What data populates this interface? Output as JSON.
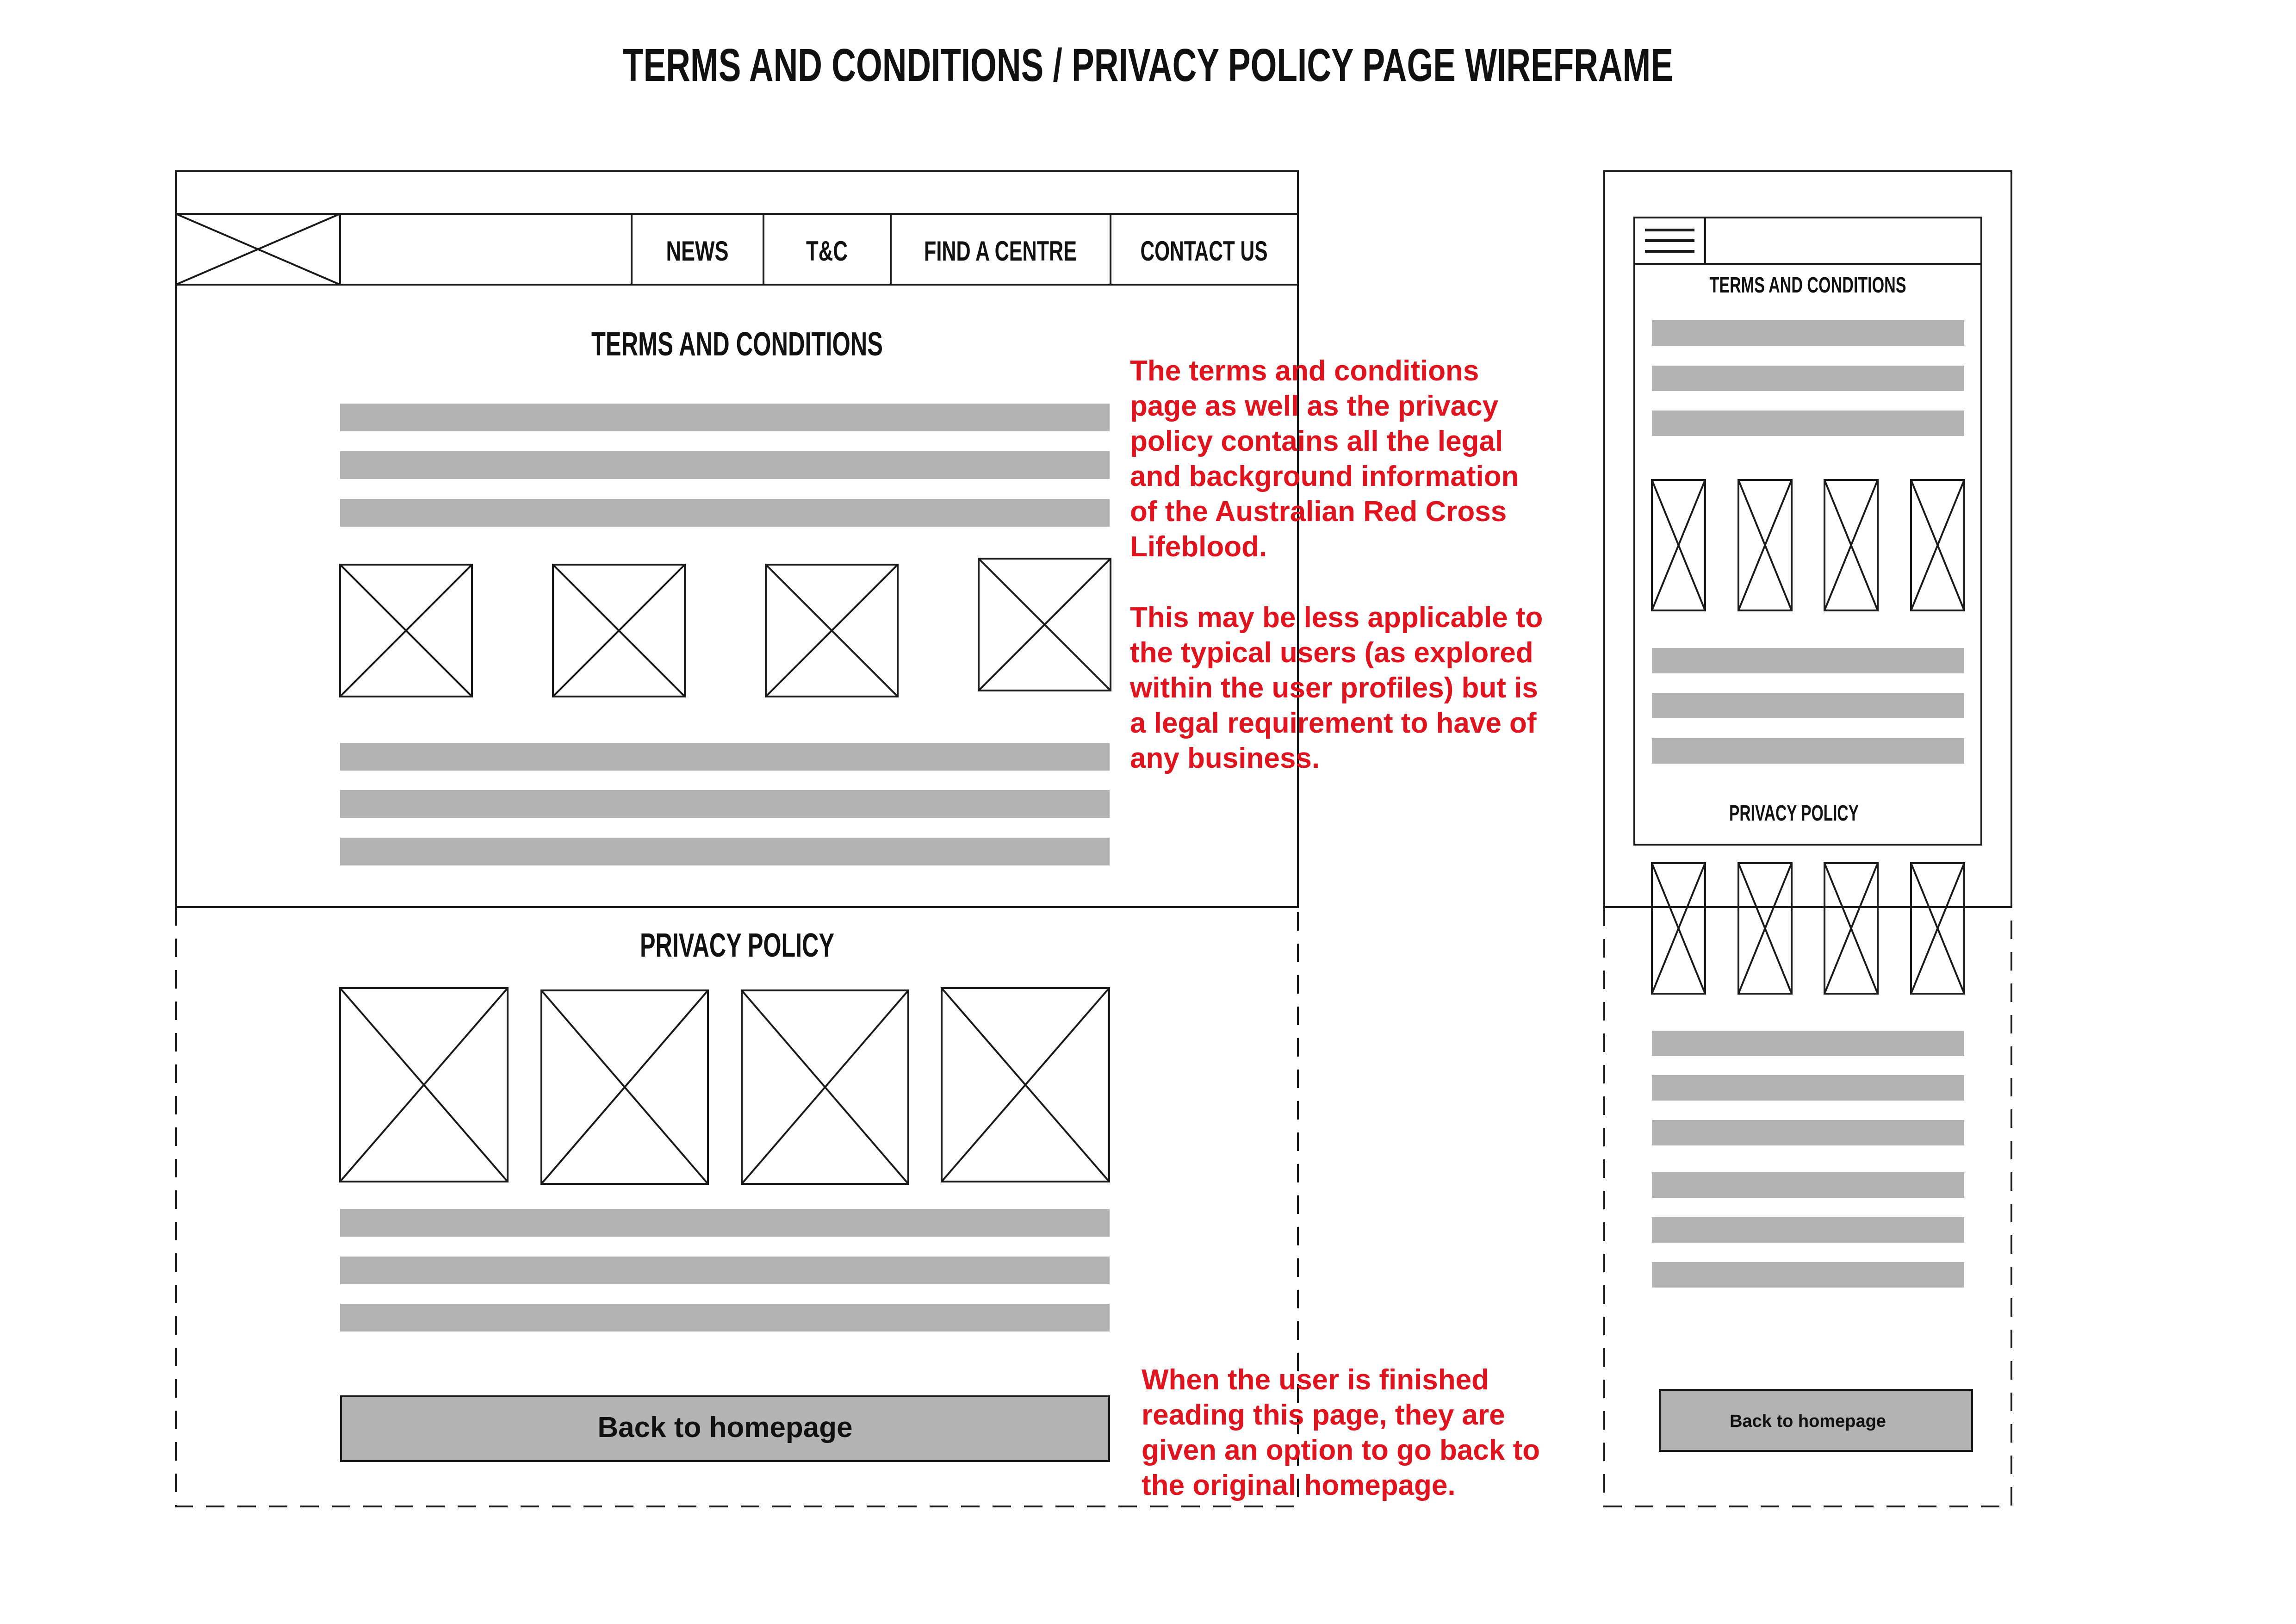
{
  "page": {
    "title": "TERMS AND CONDITIONS / PRIVACY POLICY PAGE WIREFRAME"
  },
  "colors": {
    "stroke": "#1a1a1a",
    "placeholder": "#b3b3b3",
    "annotation": "#e0141e",
    "background": "#ffffff"
  },
  "desktop": {
    "logo_icon": "image-placeholder-icon",
    "nav": [
      "NEWS",
      "T&C",
      "FIND A CENTRE",
      "CONTACT US"
    ],
    "terms_heading": "TERMS AND CONDITIONS",
    "privacy_heading": "PRIVACY POLICY",
    "back_button_label": "Back to homepage"
  },
  "mobile": {
    "menu_icon": "hamburger-menu-icon",
    "terms_heading": "TERMS AND CONDITIONS",
    "privacy_heading": "PRIVACY POLICY",
    "back_button_label": "Back to homepage"
  },
  "annotations": {
    "note_1": [
      "The terms and conditions",
      "page as well as the privacy",
      "policy contains all the legal",
      "and background information",
      "of the Australian Red Cross",
      "Lifeblood."
    ],
    "note_2": [
      "This may be less applicable to",
      "the typical users (as explored",
      "within the user profiles) but is",
      "a legal requirement to have of",
      "any business."
    ],
    "note_3": [
      "When the user is finished",
      "reading this page, they are",
      "given an option to go back to",
      "the original homepage."
    ]
  }
}
